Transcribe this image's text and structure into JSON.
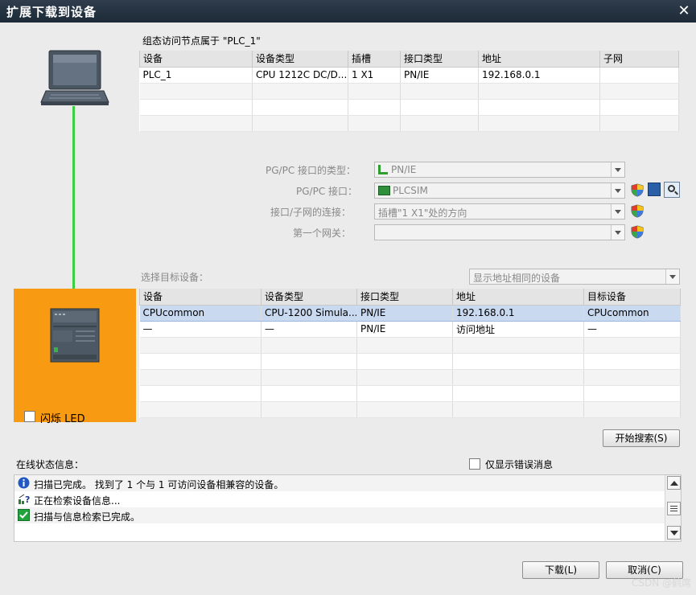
{
  "window": {
    "title": "扩展下载到设备"
  },
  "configured": {
    "heading": "组态访问节点属于 \"PLC_1\"",
    "columns": [
      "设备",
      "设备类型",
      "插槽",
      "接口类型",
      "地址",
      "子网"
    ],
    "rows": [
      [
        "PLC_1",
        "CPU 1212C DC/D...",
        "1 X1",
        "PN/IE",
        "192.168.0.1",
        ""
      ]
    ]
  },
  "interface": {
    "pgpc_type_label": "PG/PC 接口的类型：",
    "pgpc_type_value": "PN/IE",
    "pgpc_if_label": "PG/PC 接口：",
    "pgpc_if_value": "PLCSIM",
    "subnet_label": "接口/子网的连接：",
    "subnet_value": "插槽\"1 X1\"处的方向",
    "gateway_label": "第一个网关：",
    "gateway_value": ""
  },
  "target": {
    "label": "选择目标设备：",
    "filter_value": "显示地址相同的设备",
    "columns": [
      "设备",
      "设备类型",
      "接口类型",
      "地址",
      "目标设备"
    ],
    "rows": [
      [
        "CPUcommon",
        "CPU-1200 Simula...",
        "PN/IE",
        "192.168.0.1",
        "CPUcommon"
      ],
      [
        "—",
        "—",
        "PN/IE",
        "访问地址",
        "—"
      ]
    ]
  },
  "flash_led_label": "闪烁 LED",
  "search_button": "开始搜索(S)",
  "status": {
    "heading": "在线状态信息：",
    "errors_only_label": "仅显示错误消息",
    "messages": [
      {
        "icon": "info-icon",
        "text": "扫描已完成。 找到了 1 个与 1 可访问设备相兼容的设备。"
      },
      {
        "icon": "search-device-icon",
        "text": "正在检索设备信息..."
      },
      {
        "icon": "check-icon",
        "text": "扫描与信息检索已完成。"
      }
    ]
  },
  "buttons": {
    "load": "下载(L)",
    "cancel": "取消(C)"
  },
  "watermark": "CSDN @鹤席",
  "colors": {
    "orange_panel": "#f99b12",
    "link_line": "#3fce3f",
    "selected_row": "#c9d9f0"
  }
}
